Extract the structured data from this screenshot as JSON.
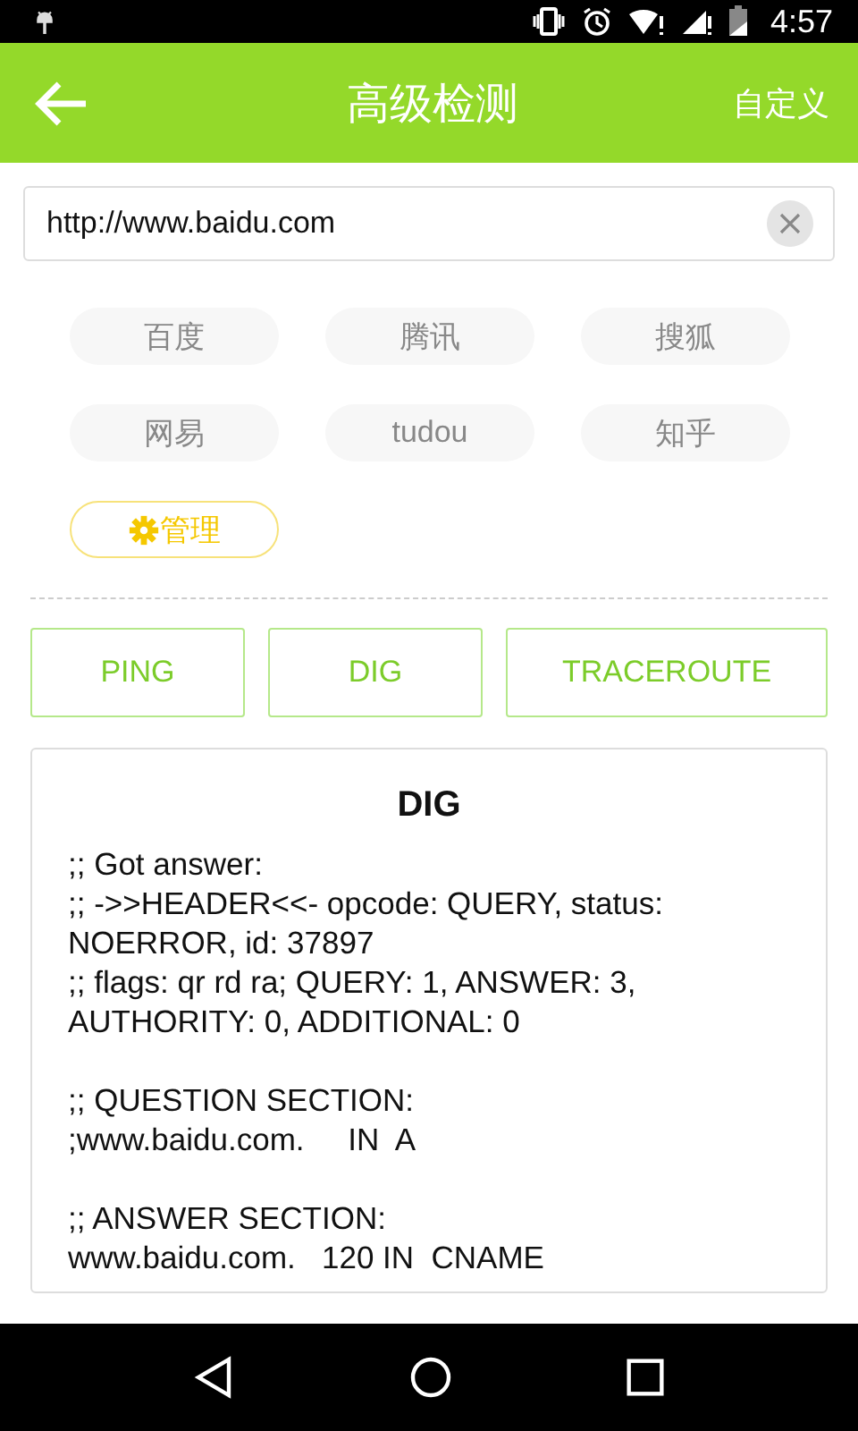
{
  "status_bar": {
    "time": "4:57"
  },
  "app_bar": {
    "title": "高级检测",
    "action": "自定义"
  },
  "url_field": {
    "value": "http://www.baidu.com"
  },
  "sites": [
    {
      "label": "百度"
    },
    {
      "label": "腾讯"
    },
    {
      "label": "搜狐"
    },
    {
      "label": "网易"
    },
    {
      "label": "tudou"
    },
    {
      "label": "知乎"
    }
  ],
  "manage_button": {
    "label": "管理"
  },
  "tools": [
    {
      "label": "PING"
    },
    {
      "label": "DIG"
    },
    {
      "label": "TRACEROUTE"
    }
  ],
  "result": {
    "title": "DIG",
    "blocks": [
      [
        ";; Got answer:",
        ";; ->>HEADER<<- opcode: QUERY, status: NOERROR, id: 37897",
        ";; flags: qr rd ra; QUERY: 1, ANSWER: 3, AUTHORITY: 0, ADDITIONAL: 0"
      ],
      [
        ";; QUESTION SECTION:",
        ";www.baidu.com.     IN  A"
      ],
      [
        ";; ANSWER SECTION:",
        "www.baidu.com.   120 IN  CNAME"
      ]
    ]
  }
}
